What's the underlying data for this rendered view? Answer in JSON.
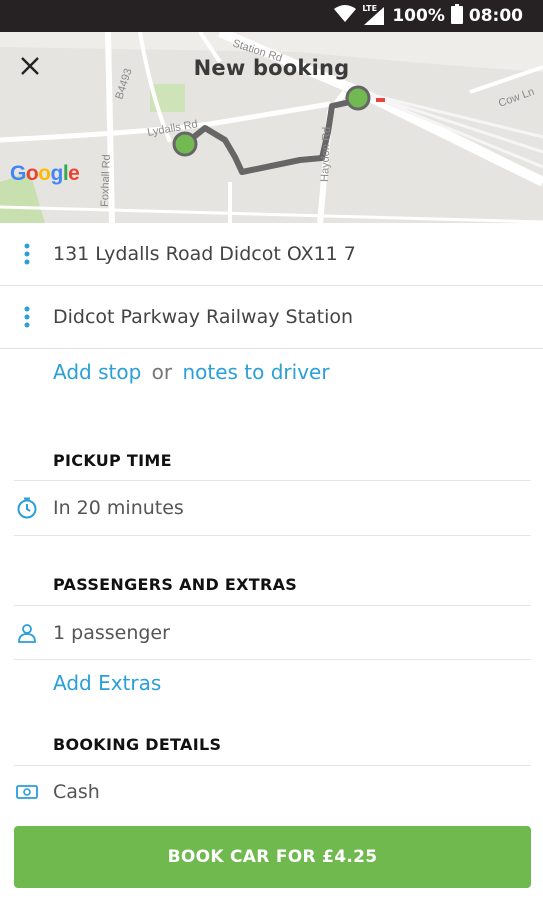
{
  "status_bar": {
    "network": "LTE",
    "battery": "100%",
    "time": "08:00"
  },
  "header": {
    "title": "New booking"
  },
  "map": {
    "logo_letters": [
      "G",
      "o",
      "o",
      "g",
      "l",
      "e"
    ],
    "logo_colors": [
      "#4285f4",
      "#ea4335",
      "#fbbc05",
      "#4285f4",
      "#34a853",
      "#ea4335"
    ],
    "street_labels": [
      "Station Rd",
      "B4493",
      "Lydalls Rd",
      "Foxhall Rd",
      "Haydon Rd",
      "Cow Ln"
    ],
    "route_color": "#666666",
    "marker_color": "#72b951"
  },
  "route": {
    "pickup": "131 Lydalls Road Didcot OX11 7",
    "dropoff": "Didcot Parkway Railway Station"
  },
  "extras_links": {
    "add_stop": "Add stop",
    "or": "or",
    "notes": "notes to driver"
  },
  "pickup_time": {
    "heading": "PICKUP TIME",
    "value": "In 20 minutes"
  },
  "passengers": {
    "heading": "PASSENGERS AND EXTRAS",
    "value": "1 passenger",
    "add_extras": "Add Extras"
  },
  "booking_details": {
    "heading": "BOOKING DETAILS",
    "payment": "Cash"
  },
  "book_button": {
    "label": "BOOK CAR FOR £4.25"
  },
  "colors": {
    "accent": "#2a9fd8",
    "primary_button": "#6fb94f"
  }
}
